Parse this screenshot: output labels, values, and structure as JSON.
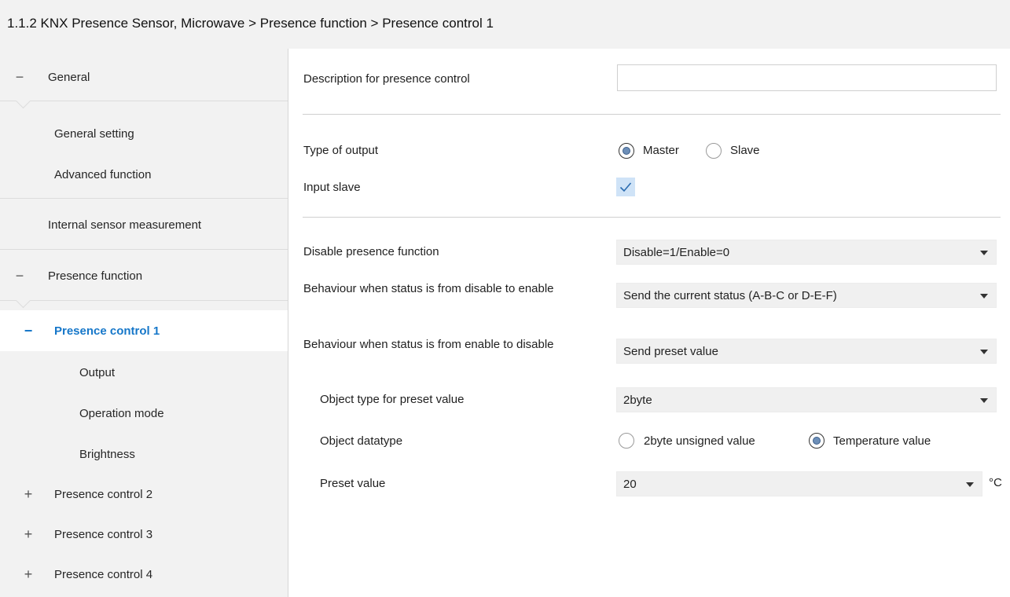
{
  "breadcrumb": "1.1.2 KNX Presence Sensor, Microwave > Presence function > Presence control 1",
  "sidebar": {
    "items": [
      {
        "label": "General",
        "sign": "−"
      },
      {
        "label": "General setting"
      },
      {
        "label": "Advanced function"
      },
      {
        "label": "Internal sensor measurement"
      },
      {
        "label": "Presence function",
        "sign": "−"
      },
      {
        "label": "Presence control 1",
        "sign": "−"
      },
      {
        "label": "Output"
      },
      {
        "label": "Operation mode"
      },
      {
        "label": "Brightness"
      },
      {
        "label": "Presence control 2",
        "sign": "+"
      },
      {
        "label": "Presence control 3",
        "sign": "+"
      },
      {
        "label": "Presence control 4",
        "sign": "+"
      }
    ]
  },
  "form": {
    "description": {
      "label": "Description for presence control",
      "value": ""
    },
    "type_of_output": {
      "label": "Type of output",
      "options": [
        "Master",
        "Slave"
      ],
      "selected": "Master"
    },
    "input_slave": {
      "label": "Input slave",
      "checked": true
    },
    "disable_presence": {
      "label": "Disable presence function",
      "value": "Disable=1/Enable=0"
    },
    "behaviour_enable": {
      "label": "Behaviour when status is from disable to enable",
      "value": "Send the current status (A-B-C or D-E-F)"
    },
    "behaviour_disable": {
      "label": "Behaviour when status is from enable to disable",
      "value": "Send preset value"
    },
    "object_type": {
      "label": "Object type for preset value",
      "value": "2byte"
    },
    "object_datatype": {
      "label": "Object datatype",
      "options": [
        "2byte unsigned value",
        "Temperature value"
      ],
      "selected": "Temperature value"
    },
    "preset_value": {
      "label": "Preset value",
      "value": "20",
      "unit": "°C"
    }
  },
  "colors": {
    "accent": "#1677c9",
    "sidebar_bg": "#f2f2f2",
    "checkbox_bg": "#cfe3f7"
  }
}
